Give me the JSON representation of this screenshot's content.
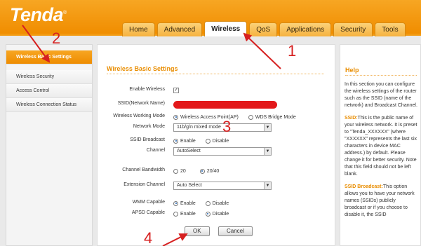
{
  "header": {
    "brand": "Tenda",
    "trademark": "®",
    "tabs": [
      {
        "label": "Home"
      },
      {
        "label": "Advanced"
      },
      {
        "label": "Wireless",
        "active": true
      },
      {
        "label": "QoS"
      },
      {
        "label": "Applications"
      },
      {
        "label": "Security"
      },
      {
        "label": "Tools"
      }
    ]
  },
  "sidebar": {
    "items": [
      {
        "label": "Wireless Basic Settings",
        "active": true
      },
      {
        "label": "Wireless Security"
      },
      {
        "label": "Access Control"
      },
      {
        "label": "Wireless Connection Status"
      }
    ]
  },
  "main": {
    "title": "Wireless Basic Settings",
    "enable_wireless": {
      "label": "Enable Wireless",
      "checked": true,
      "mark": "✓"
    },
    "ssid": {
      "label": "SSID(Network Name)"
    },
    "working_mode": {
      "label": "Wireless Working Mode",
      "options": [
        "Wireless Access Point(AP)",
        "WDS Bridge Mode"
      ],
      "selected": 0
    },
    "network_mode": {
      "label": "Network Mode",
      "value": "11b/g/n mixed mode"
    },
    "ssid_broadcast": {
      "label": "SSID Broadcast",
      "options": [
        "Enable",
        "Disable"
      ],
      "selected": 0
    },
    "channel": {
      "label": "Channel",
      "value": "AutoSelect"
    },
    "channel_bandwidth": {
      "label": "Channel Bandwidth",
      "options": [
        "20",
        "20/40"
      ],
      "selected": 1
    },
    "extension_channel": {
      "label": "Extension Channel",
      "value": "Auto Select"
    },
    "wmm": {
      "label": "WMM Capable",
      "options": [
        "Enable",
        "Disable"
      ],
      "selected": 0
    },
    "apsd": {
      "label": "APSD Capable",
      "options": [
        "Enable",
        "Disable"
      ],
      "selected": 1
    },
    "ok_label": "OK",
    "cancel_label": "Cancel",
    "select_arrow": "▼"
  },
  "help": {
    "title": "Help",
    "intro": "In this section you can configure the wireless settings of the router such as the SSID (name of the network) and Broadcast Channel.",
    "ssid_head": "SSID:",
    "ssid_body": "This is the public name of your wireless network. It is preset to \"Tenda_XXXXXX\" (where \"XXXXXX\" represents the last six characters in device MAC address.) by default. Please change it for better security. Note that this field should not be left blank.",
    "broadcast_head": "SSID Broadcast:",
    "broadcast_body": "This option allows you to have your network names (SSIDs) publicly broadcast or if you choose to disable it, the SSID"
  },
  "annotations": {
    "n1": "1",
    "n2": "2",
    "n3": "3",
    "n4": "4",
    "color": "#d62020"
  },
  "colors": {
    "accent": "#f08d00",
    "title": "#e98d00",
    "redact": "#e3191b"
  }
}
